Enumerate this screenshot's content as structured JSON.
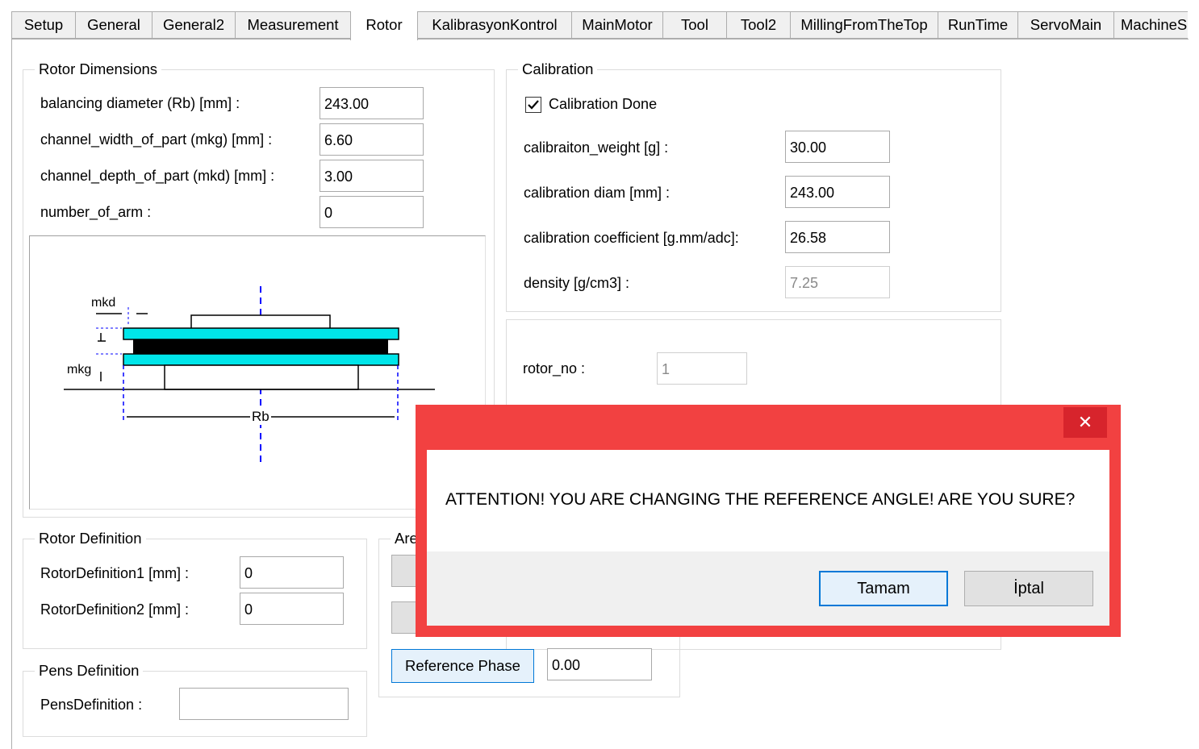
{
  "tabs": [
    "Setup",
    "General",
    "General2",
    "Measurement",
    "Rotor",
    "KalibrasyonKontrol",
    "MainMotor",
    "Tool",
    "Tool2",
    "MillingFromTheTop",
    "RunTime",
    "ServoMain",
    "MachineS"
  ],
  "active_tab": "Rotor",
  "rotor_dimensions": {
    "title": "Rotor Dimensions",
    "fields": [
      {
        "label": "balancing diameter (Rb) [mm] :",
        "value": "243.00"
      },
      {
        "label": "channel_width_of_part (mkg) [mm] :",
        "value": "6.60"
      },
      {
        "label": "channel_depth_of_part (mkd) [mm] :",
        "value": "3.00"
      },
      {
        "label": "number_of_arm :",
        "value": "0"
      }
    ],
    "diagram": {
      "mkd": "mkd",
      "mkg": "mkg",
      "rb": "Rb"
    }
  },
  "calibration": {
    "title": "Calibration",
    "checkbox_label": "Calibration Done",
    "checked": true,
    "fields": [
      {
        "label": "calibraiton_weight [g] :",
        "value": "30.00"
      },
      {
        "label": "calibration diam [mm] :",
        "value": "243.00"
      },
      {
        "label": "calibration coefficient [g.mm/adc]:",
        "value": "26.58"
      },
      {
        "label": "density [g/cm3] :",
        "value": "7.25"
      }
    ]
  },
  "rotor_no": {
    "label": "rotor_no :",
    "value": "1"
  },
  "rotor_definition": {
    "title": "Rotor Definition",
    "fields": [
      {
        "label": "RotorDefinition1 [mm] :",
        "value": "0"
      },
      {
        "label": "RotorDefinition2 [mm] :",
        "value": "0"
      }
    ]
  },
  "pens_definition": {
    "title": "Pens Definition",
    "label": "PensDefinition :",
    "value": ""
  },
  "area_group": {
    "title_partial": "Are",
    "reference_phase_label": "Reference Phase",
    "reference_phase_value": "0.00"
  },
  "dialog": {
    "close_glyph": "✕",
    "message": "ATTENTION! YOU ARE CHANGING THE REFERENCE ANGLE! ARE YOU SURE?",
    "ok_label": "Tamam",
    "cancel_label": "İptal",
    "accent_color": "#f24141"
  }
}
